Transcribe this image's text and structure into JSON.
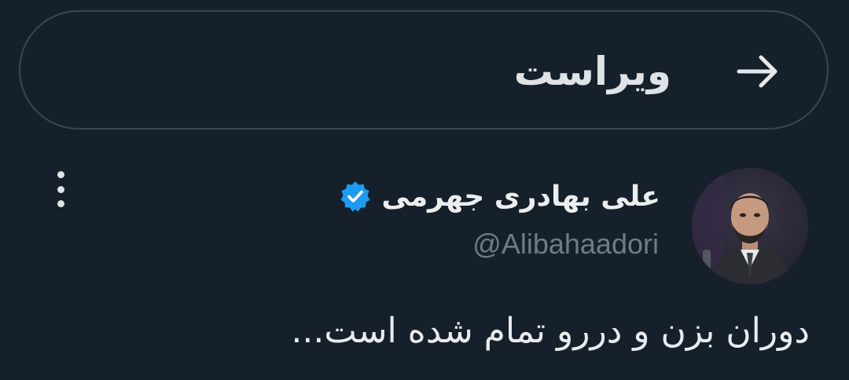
{
  "header": {
    "title": "ویراست",
    "back_icon": "arrow-right-icon"
  },
  "post": {
    "author": {
      "display_name": "علی بهادری جهرمی",
      "handle": "@Alibahaadori",
      "verified": true,
      "verified_color": "#1d9bf0",
      "avatar": "profile-photo"
    },
    "more_icon": "vertical-dots-icon",
    "text": "دوران بزن و دررو تمام شده است..."
  },
  "colors": {
    "background": "#16202b",
    "border": "#3d4650",
    "primary_text": "#e7e9ea",
    "secondary_text": "#6f7b86",
    "accent": "#1d9bf0"
  }
}
